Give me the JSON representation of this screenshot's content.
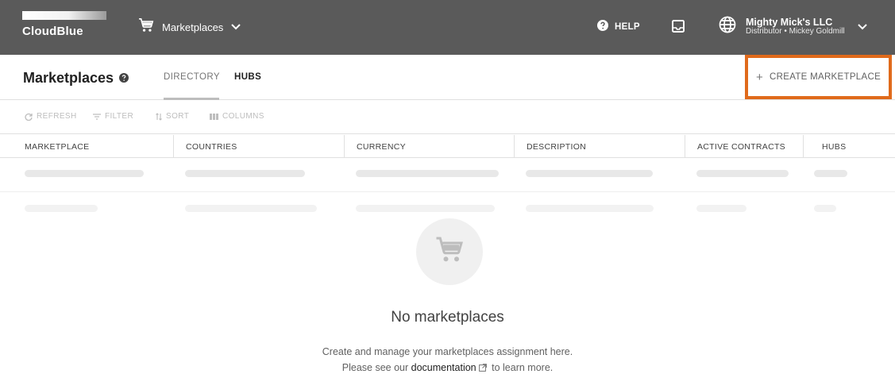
{
  "app": {
    "logo_text": "CloudBlue"
  },
  "topbar": {
    "module_label": "Marketplaces",
    "help_label": "HELP",
    "account_name": "Mighty Mick's LLC",
    "account_role": "Distributor • Mickey Goldmill"
  },
  "page": {
    "title": "Marketplaces",
    "tabs": [
      {
        "label": "DIRECTORY"
      },
      {
        "label": "HUBS"
      }
    ],
    "create_label": "CREATE MARKETPLACE"
  },
  "toolbar": {
    "refresh_label": "REFRESH",
    "filter_label": "FILTER",
    "sort_label": "SORT",
    "columns_label": "COLUMNS"
  },
  "table": {
    "columns": [
      "MARKETPLACE",
      "COUNTRIES",
      "CURRENCY",
      "DESCRIPTION",
      "ACTIVE CONTRACTS",
      "HUBS"
    ]
  },
  "empty_state": {
    "title": "No marketplaces",
    "line1": "Create and manage your marketplaces assignment here.",
    "line2_prefix": "Please see our",
    "link_text": "documentation",
    "line2_suffix": "to learn more."
  },
  "icons": {
    "cart": "cart-icon",
    "help": "help-icon",
    "inbox": "inbox-icon",
    "globe": "globe-icon",
    "chevron": "chevron-down-icon",
    "external": "external-link-icon"
  },
  "colors": {
    "topbar_bg": "#5a5a5a",
    "highlight_border": "#e06a1b",
    "skeleton": "#e8e8e8"
  }
}
